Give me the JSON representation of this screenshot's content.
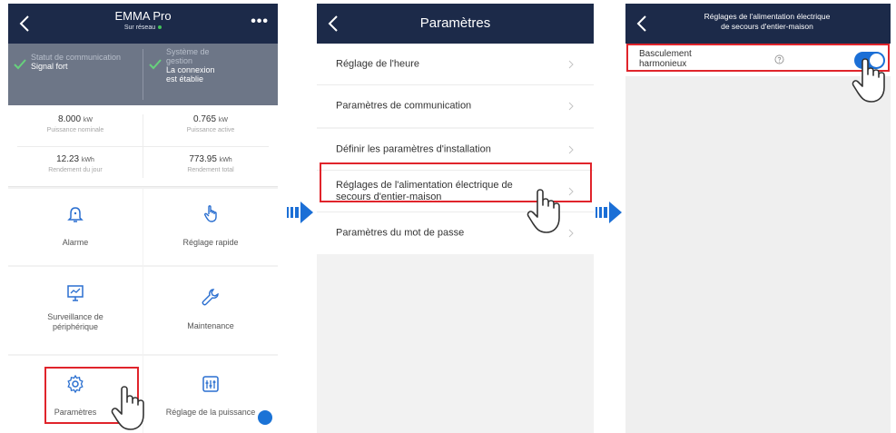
{
  "screen1": {
    "title": "EMMA Pro",
    "status": "Sur réseau",
    "comm": {
      "label": "Statut de communication",
      "value": "Signal fort"
    },
    "mgmt": {
      "label_1": "Système de",
      "label_2": "gestion",
      "value_1": "La connexion",
      "value_2": "est établie"
    },
    "kpis": [
      {
        "value": "8.000",
        "unit": "kW",
        "label": "Puissance nominale"
      },
      {
        "value": "0.765",
        "unit": "kW",
        "label": "Puissance active"
      },
      {
        "value": "12.23",
        "unit": "kWh",
        "label": "Rendement du jour"
      },
      {
        "value": "773.95",
        "unit": "kWh",
        "label": "Rendement total"
      }
    ],
    "tiles": {
      "alarm": "Alarme",
      "quick": "Réglage rapide",
      "device_1": "Surveillance de",
      "device_2": "périphérique",
      "maintenance": "Maintenance",
      "settings": "Paramètres",
      "power": "Réglage de la puissance"
    }
  },
  "screen2": {
    "title": "Paramètres",
    "items": [
      "Réglage de l'heure",
      "Paramètres de communication",
      "Définir les paramètres d'installation",
      "Réglages de l'alimentation électrique de secours d'entier-maison",
      "Paramètres du mot de passe"
    ]
  },
  "screen3": {
    "title_1": "Réglages de l'alimentation électrique",
    "title_2": "de secours d'entier-maison",
    "toggle_label_1": "Basculement",
    "toggle_label_2": "harmonieux",
    "toggle_on": true
  },
  "colors": {
    "header": "#1c2a49",
    "accent": "#1b6fd6",
    "highlight": "#e0242b",
    "status_bar": "#6d7687"
  },
  "icons": [
    "back-arrow-icon",
    "more-icon",
    "check-icon",
    "bell-icon",
    "touch-icon",
    "monitor-icon",
    "wrench-icon",
    "gear-icon",
    "sliders-icon",
    "chevron-right-icon",
    "help-icon",
    "hand-pointer-icon",
    "next-step-arrow-icon"
  ]
}
